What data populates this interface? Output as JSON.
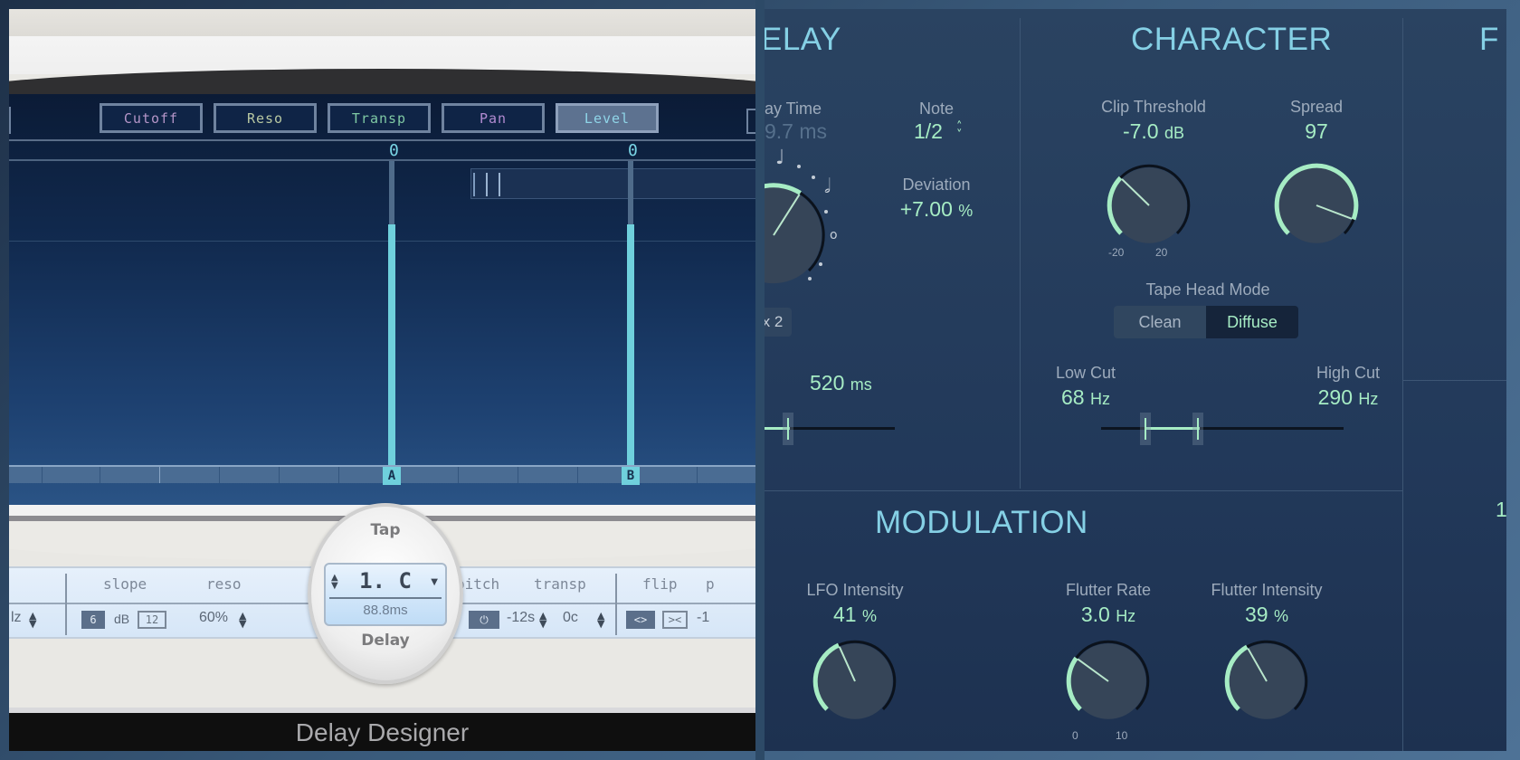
{
  "delay_designer": {
    "title": "Delay Designer",
    "param_tabs": [
      {
        "label": "Cutoff",
        "active": false
      },
      {
        "label": "Reso",
        "active": false
      },
      {
        "label": "Transp",
        "active": false
      },
      {
        "label": "Pan",
        "active": false
      },
      {
        "label": "Level",
        "active": true
      }
    ],
    "taps": [
      {
        "id": "A",
        "value_label": "0"
      },
      {
        "id": "B",
        "value_label": "0"
      }
    ],
    "tap_dial": {
      "top_label": "Tap",
      "bottom_label": "Delay",
      "selected_tap": "1. C",
      "delay_ms": "88.8ms"
    },
    "controls": {
      "slope_label": "slope",
      "slope_db_6": "6",
      "slope_unit": "dB",
      "slope_db_12": "12",
      "reso_label": "reso",
      "reso_value": "60%",
      "cutoff_value_partial": "lz",
      "pitch_label": "pitch",
      "pitch_toggle": "⏻",
      "transp_label": "transp",
      "transp_semitones": "-12s",
      "transp_cents": "0c",
      "flip_label": "flip",
      "flip_left": "<>",
      "flip_right": "><",
      "pan_label_partial": "p",
      "pan_value_partial": "-1"
    }
  },
  "tape_delay": {
    "delay": {
      "title_partial": "ELAY",
      "delay_time_label": "ay Time",
      "delay_time_value": "9.7 ms",
      "note_label": "Note",
      "note_value": "1/2",
      "deviation_label": "Deviation",
      "deviation_value": "+7.00",
      "deviation_unit": "%",
      "multiplier_button": "x 2",
      "slider_value": "520",
      "slider_unit": "ms",
      "knob_fraction": 0.62
    },
    "character": {
      "title": "CHARACTER",
      "clip_threshold_label": "Clip Threshold",
      "clip_threshold_value": "-7.0",
      "clip_threshold_unit": "dB",
      "clip_threshold_min": "-20",
      "clip_threshold_max": "20",
      "clip_threshold_fraction": 0.33,
      "spread_label": "Spread",
      "spread_value": "97",
      "spread_fraction": 0.91,
      "tape_head_mode_label": "Tape Head Mode",
      "tape_head_modes": [
        "Clean",
        "Diffuse"
      ],
      "tape_head_selected": "Diffuse",
      "low_cut_label": "Low Cut",
      "low_cut_value": "68",
      "low_cut_unit": "Hz",
      "high_cut_label": "High Cut",
      "high_cut_value": "290",
      "high_cut_unit": "Hz"
    },
    "modulation": {
      "title": "MODULATION",
      "lfo_intensity_label": "LFO Intensity",
      "lfo_intensity_value": "41",
      "lfo_intensity_unit": "%",
      "flutter_rate_label": "Flutter Rate",
      "flutter_rate_value": "3.0",
      "flutter_rate_unit": "Hz",
      "flutter_rate_min": "0",
      "flutter_rate_max": "10",
      "flutter_rate_fraction": 0.3,
      "flutter_intensity_label": "Flutter Intensity",
      "flutter_intensity_value": "39",
      "flutter_intensity_unit": "%"
    },
    "partial_right": {
      "title_partial": "F",
      "value_partial": "1"
    },
    "colors": {
      "accent_green": "#a6ecc4",
      "title_cyan": "#85d0e5",
      "tap_cyan": "#6fd0dc"
    }
  }
}
